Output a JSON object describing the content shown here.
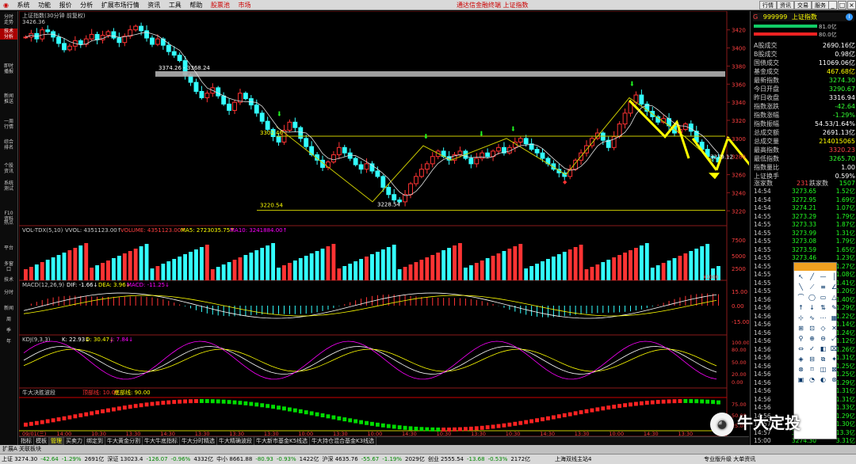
{
  "menu": {
    "items": [
      "系统",
      "功能",
      "报价",
      "分析",
      "扩展市场行情",
      "资讯",
      "工具",
      "帮助",
      "股票池",
      "市场"
    ],
    "app_title": "通达信金融终端 上证指数",
    "right_buttons": [
      "行情",
      "资讯",
      "交易",
      "服务"
    ]
  },
  "left_tabs": [
    "分时走势",
    "技术分析",
    "即时播报",
    "新闻推送",
    "一周行情",
    "综合排名",
    "个股资讯",
    "系统测试",
    "F10资料",
    "热点",
    "平台",
    "多窗口",
    "技术",
    "分时",
    "新闻",
    "周",
    "季",
    "年"
  ],
  "chart_header": {
    "title": "上证指数(30分钟 前复权)",
    "high_label": "3426.36"
  },
  "annotations": {
    "range_label": "3374.26 - 3368.24",
    "ref_3302": "3302.46",
    "ref_3220": "3220.54",
    "low_label": "3228.54",
    "end_label": "3279.12"
  },
  "price_axis": [
    "3420",
    "3400",
    "3380",
    "3360",
    "3340",
    "3320",
    "3300",
    "3280",
    "3260",
    "3240",
    "3220"
  ],
  "indicators": {
    "vol": {
      "name": "VOL-TDX(5,10)",
      "vvol": "VVOL: 4351123.00↑",
      "volume": "VOLUME: 4351123.00↑",
      "ma5": "MA5: 2723035.75↑",
      "ma10": "MA10: 3241884.00↑",
      "axis": [
        "7500",
        "5000",
        "2500"
      ],
      "unit": "X1000"
    },
    "macd": {
      "name": "MACD(12,26,9)",
      "dif": "DIF: -1.66↓",
      "dea": "DEA: 3.96↓",
      "macd": "MACD: -11.25↓",
      "axis": [
        "15.00",
        "0.00",
        "-15.00"
      ]
    },
    "kdj": {
      "name": "KDJ(9,3,3)",
      "k": "K: 22.93↓",
      "d": "D: 30.47↓",
      "j": "J: 7.84↓",
      "axis": [
        "100.00",
        "80.00",
        "50.00",
        "20.00",
        "0.00"
      ]
    },
    "nd": {
      "name": "牛大决胜波段",
      "top": "顶部线: 10.00",
      "bottom": "底部线: 90.00",
      "axis": [
        "75.00",
        "50.00",
        "25.00"
      ]
    }
  },
  "time_axis": [
    "09/01(三)",
    "14:00",
    "10:30",
    "13:30",
    "14:30",
    "13:30",
    "13:30",
    "13:30",
    "10:00",
    "13:30",
    "10:00",
    "14:30",
    "10:30",
    "13:30",
    "10:30",
    "14:30",
    "13:30",
    "10:00",
    "14:30",
    "13:30"
  ],
  "right_panel": {
    "code": "999999",
    "name": "上证指数",
    "prefix": "G",
    "bar1": "81.0亿",
    "bar2": "80.0亿",
    "stats": [
      {
        "label": "A股成交",
        "value": "2690.16亿",
        "color": "#ffffff"
      },
      {
        "label": "B股成交",
        "value": "0.98亿",
        "color": "#ffffff"
      },
      {
        "label": "国债成交",
        "value": "11069.06亿",
        "color": "#ffffff"
      },
      {
        "label": "基金成交",
        "value": "467.68亿",
        "color": "#ffff00"
      },
      {
        "label": "最新指数",
        "value": "3274.30",
        "color": "#33ff33"
      },
      {
        "label": "今日开盘",
        "value": "3290.67",
        "color": "#33ff33"
      },
      {
        "label": "昨日收盘",
        "value": "3316.94",
        "color": "#ffffff"
      },
      {
        "label": "指数涨跌",
        "value": "-42.64",
        "color": "#33ff33"
      },
      {
        "label": "指数涨幅",
        "value": "-1.29%",
        "color": "#33ff33"
      },
      {
        "label": "指数振幅",
        "value": "54.53/1.64%",
        "color": "#ffffff"
      },
      {
        "label": "总成交额",
        "value": "2691.13亿",
        "color": "#ffffff"
      },
      {
        "label": "总成交量",
        "value": "214015065",
        "color": "#ffff00"
      },
      {
        "label": "最高指数",
        "value": "3320.23",
        "color": "#ff4444"
      },
      {
        "label": "最低指数",
        "value": "3265.70",
        "color": "#33ff33"
      },
      {
        "label": "指数量比",
        "value": "1.00",
        "color": "#ffffff"
      },
      {
        "label": "上证换手",
        "value": "0.59%",
        "color": "#ffffff"
      }
    ],
    "ud_label": "涨家数",
    "up_count": "231",
    "down_label": "跌家数",
    "down_count": "1507",
    "ticks": [
      {
        "t": "14:54",
        "p": "3273.65",
        "v": "1.52亿"
      },
      {
        "t": "14:54",
        "p": "3272.95",
        "v": "1.69亿"
      },
      {
        "t": "14:54",
        "p": "3274.21",
        "v": "1.07亿"
      },
      {
        "t": "14:55",
        "p": "3273.29",
        "v": "1.79亿"
      },
      {
        "t": "14:55",
        "p": "3273.33",
        "v": "1.87亿"
      },
      {
        "t": "14:55",
        "p": "3273.99",
        "v": "1.31亿"
      },
      {
        "t": "14:55",
        "p": "3273.08",
        "v": "1.79亿"
      },
      {
        "t": "14:55",
        "p": "3273.59",
        "v": "1.65亿"
      },
      {
        "t": "14:55",
        "p": "3273.46",
        "v": "1.23亿"
      },
      {
        "t": "14:55",
        "p": "",
        "v": "1.27亿"
      },
      {
        "t": "14:55",
        "p": "",
        "v": "1.08亿"
      },
      {
        "t": "14:55",
        "p": "",
        "v": "1.41亿"
      },
      {
        "t": "14:55",
        "p": "",
        "v": "1.20亿"
      },
      {
        "t": "14:56",
        "p": "",
        "v": "1.40亿"
      },
      {
        "t": "14:56",
        "p": "",
        "v": "1.29亿"
      },
      {
        "t": "14:56",
        "p": "",
        "v": "1.22亿"
      },
      {
        "t": "14:56",
        "p": "",
        "v": "1.14亿"
      },
      {
        "t": "14:56",
        "p": "",
        "v": "1.24亿"
      },
      {
        "t": "14:56",
        "p": "",
        "v": "1.12亿"
      },
      {
        "t": "14:56",
        "p": "",
        "v": "1.26亿"
      },
      {
        "t": "14:56",
        "p": "",
        "v": "1.31亿"
      },
      {
        "t": "14:56",
        "p": "",
        "v": "1.25亿"
      },
      {
        "t": "14:56",
        "p": "",
        "v": "1.25亿"
      },
      {
        "t": "14:56",
        "p": "",
        "v": "1.29亿"
      },
      {
        "t": "14:56",
        "p": "",
        "v": "1.31亿"
      },
      {
        "t": "14:56",
        "p": "",
        "v": "1.31亿"
      },
      {
        "t": "14:56",
        "p": "",
        "v": "1.33亿"
      },
      {
        "t": "14:56",
        "p": "",
        "v": "1.29亿"
      },
      {
        "t": "14:57",
        "p": "",
        "v": "1.30亿"
      },
      {
        "t": "14:57",
        "p": "3279.12",
        "v": "13.3亿"
      },
      {
        "t": "15:00",
        "p": "3274.30",
        "v": "3.31亿"
      }
    ]
  },
  "bottom_tabs": [
    "指标",
    "模板",
    "管理",
    "买卖力",
    "绑定到",
    "牛大黄金分割",
    "牛大牛底指标",
    "牛大分时精选",
    "牛大精确波段",
    "牛大新市基金K5线选",
    "牛大持仓混合基金K3线选"
  ],
  "watermark": "牛大定投",
  "ext_label": "扩展A 关联板块",
  "statusbar": {
    "items": [
      {
        "text": "上证 3274.30",
        "cls": ""
      },
      {
        "text": "-42.64",
        "cls": "dn"
      },
      {
        "text": "-1.29%",
        "cls": "dn"
      },
      {
        "text": "2691亿",
        "cls": ""
      },
      {
        "text": "深证 13023.4",
        "cls": ""
      },
      {
        "text": "-126.07",
        "cls": "dn"
      },
      {
        "text": "-0.96%",
        "cls": "dn"
      },
      {
        "text": "4332亿",
        "cls": ""
      },
      {
        "text": "中小 8661.88",
        "cls": ""
      },
      {
        "text": "-80.93",
        "cls": "dn"
      },
      {
        "text": "-0.93%",
        "cls": "dn"
      },
      {
        "text": "1422亿",
        "cls": ""
      },
      {
        "text": "沪深 4635.76",
        "cls": ""
      },
      {
        "text": "-55.67",
        "cls": "dn"
      },
      {
        "text": "-1.19%",
        "cls": "dn"
      },
      {
        "text": "2029亿",
        "cls": ""
      },
      {
        "text": "创业 2555.54",
        "cls": ""
      },
      {
        "text": "-13.68",
        "cls": "dn"
      },
      {
        "text": "-0.53%",
        "cls": "dn"
      },
      {
        "text": "2172亿",
        "cls": ""
      }
    ],
    "market": "上海双线主站4",
    "right_text": "专业版升级 大单资讯"
  },
  "colors": {
    "up": "#ff3333",
    "down": "#33ffff",
    "ma_yellow": "#ffff00",
    "accent_arrow": "#ffff00",
    "band_green": "#00dd00",
    "band_red": "#ff2222"
  }
}
